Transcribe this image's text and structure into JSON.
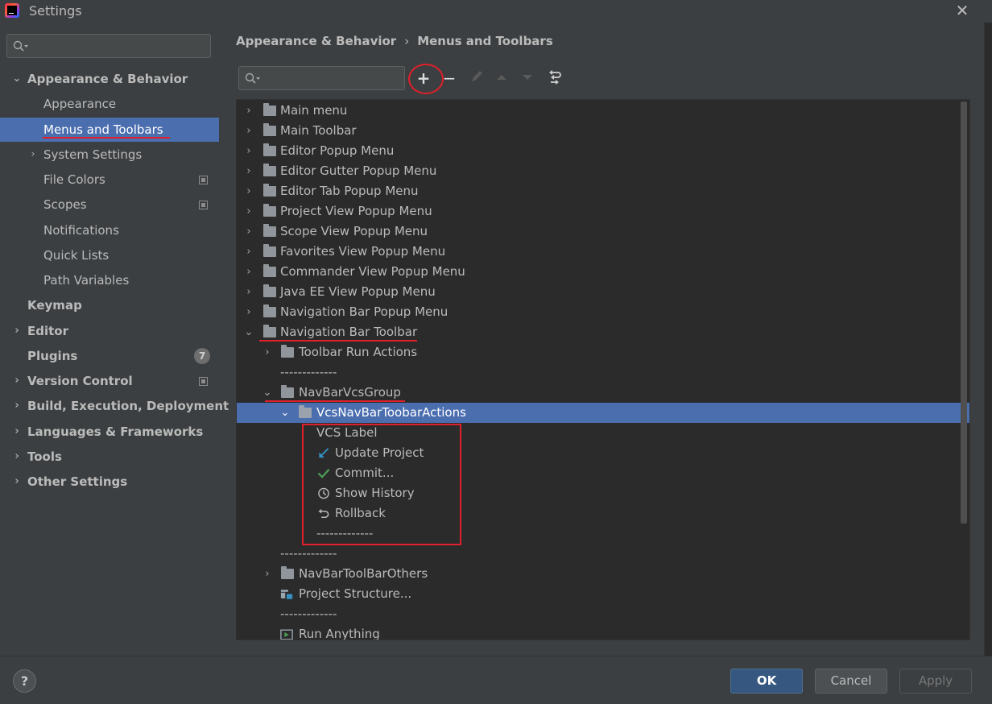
{
  "window": {
    "title": "Settings",
    "close_icon": "close-icon"
  },
  "sidebar": {
    "search_placeholder": "",
    "items": [
      {
        "label": "Appearance & Behavior",
        "expanded": true,
        "bold": true
      },
      {
        "label": "Appearance"
      },
      {
        "label": "Menus and Toolbars",
        "selected": true
      },
      {
        "label": "System Settings",
        "expandable": true
      },
      {
        "label": "File Colors",
        "project_icon": true
      },
      {
        "label": "Scopes",
        "project_icon": true
      },
      {
        "label": "Notifications"
      },
      {
        "label": "Quick Lists"
      },
      {
        "label": "Path Variables"
      },
      {
        "label": "Keymap",
        "bold": true
      },
      {
        "label": "Editor",
        "bold": true,
        "expandable": true
      },
      {
        "label": "Plugins",
        "bold": true,
        "badge": "7"
      },
      {
        "label": "Version Control",
        "bold": true,
        "expandable": true,
        "project_icon": true
      },
      {
        "label": "Build, Execution, Deployment",
        "bold": true,
        "expandable": true
      },
      {
        "label": "Languages & Frameworks",
        "bold": true,
        "expandable": true
      },
      {
        "label": "Tools",
        "bold": true,
        "expandable": true
      },
      {
        "label": "Other Settings",
        "bold": true,
        "expandable": true
      }
    ]
  },
  "breadcrumb": {
    "parent": "Appearance & Behavior",
    "separator": "›",
    "current": "Menus and Toolbars"
  },
  "toolbar": {
    "search_placeholder": "",
    "add": "+",
    "remove": "−"
  },
  "tree": {
    "rows": [
      {
        "label": "Main menu",
        "type": "folder",
        "collapsed": true
      },
      {
        "label": "Main Toolbar",
        "type": "folder",
        "collapsed": true
      },
      {
        "label": "Editor Popup Menu",
        "type": "folder",
        "collapsed": true
      },
      {
        "label": "Editor Gutter Popup Menu",
        "type": "folder",
        "collapsed": true
      },
      {
        "label": "Editor Tab Popup Menu",
        "type": "folder",
        "collapsed": true
      },
      {
        "label": "Project View Popup Menu",
        "type": "folder",
        "collapsed": true
      },
      {
        "label": "Scope View Popup Menu",
        "type": "folder",
        "collapsed": true
      },
      {
        "label": "Favorites View Popup Menu",
        "type": "folder",
        "collapsed": true
      },
      {
        "label": "Commander View Popup Menu",
        "type": "folder",
        "collapsed": true
      },
      {
        "label": "Java EE View Popup Menu",
        "type": "folder",
        "collapsed": true
      },
      {
        "label": "Navigation Bar Popup Menu",
        "type": "folder",
        "collapsed": true
      },
      {
        "label": "Navigation Bar Toolbar",
        "type": "folder",
        "expanded": true
      },
      {
        "label": "Toolbar Run Actions",
        "type": "folder",
        "collapsed": true
      },
      {
        "label": "-------------",
        "type": "separator"
      },
      {
        "label": "NavBarVcsGroup",
        "type": "folder",
        "expanded": true
      },
      {
        "label": "VcsNavBarToobarActions",
        "type": "folder",
        "expanded": true,
        "selected": true
      },
      {
        "label": "VCS Label",
        "type": "action"
      },
      {
        "label": "Update Project",
        "type": "action",
        "icon": "update-arrow-icon"
      },
      {
        "label": "Commit...",
        "type": "action",
        "icon": "checkmark-icon"
      },
      {
        "label": "Show History",
        "type": "action",
        "icon": "clock-icon"
      },
      {
        "label": "Rollback",
        "type": "action",
        "icon": "undo-icon"
      },
      {
        "label": "-------------",
        "type": "separator"
      },
      {
        "label": "-------------",
        "type": "separator"
      },
      {
        "label": "NavBarToolBarOthers",
        "type": "folder",
        "collapsed": true
      },
      {
        "label": "Project Structure...",
        "type": "action",
        "icon": "project-structure-icon"
      },
      {
        "label": "-------------",
        "type": "separator"
      },
      {
        "label": "Run Anything",
        "type": "action",
        "icon": "run-anything-icon"
      }
    ]
  },
  "footer": {
    "help": "?",
    "ok": "OK",
    "cancel": "Cancel",
    "apply": "Apply"
  },
  "colors": {
    "selection": "#4b6eaf",
    "annotation": "#e0202a",
    "primary_button": "#365880"
  }
}
